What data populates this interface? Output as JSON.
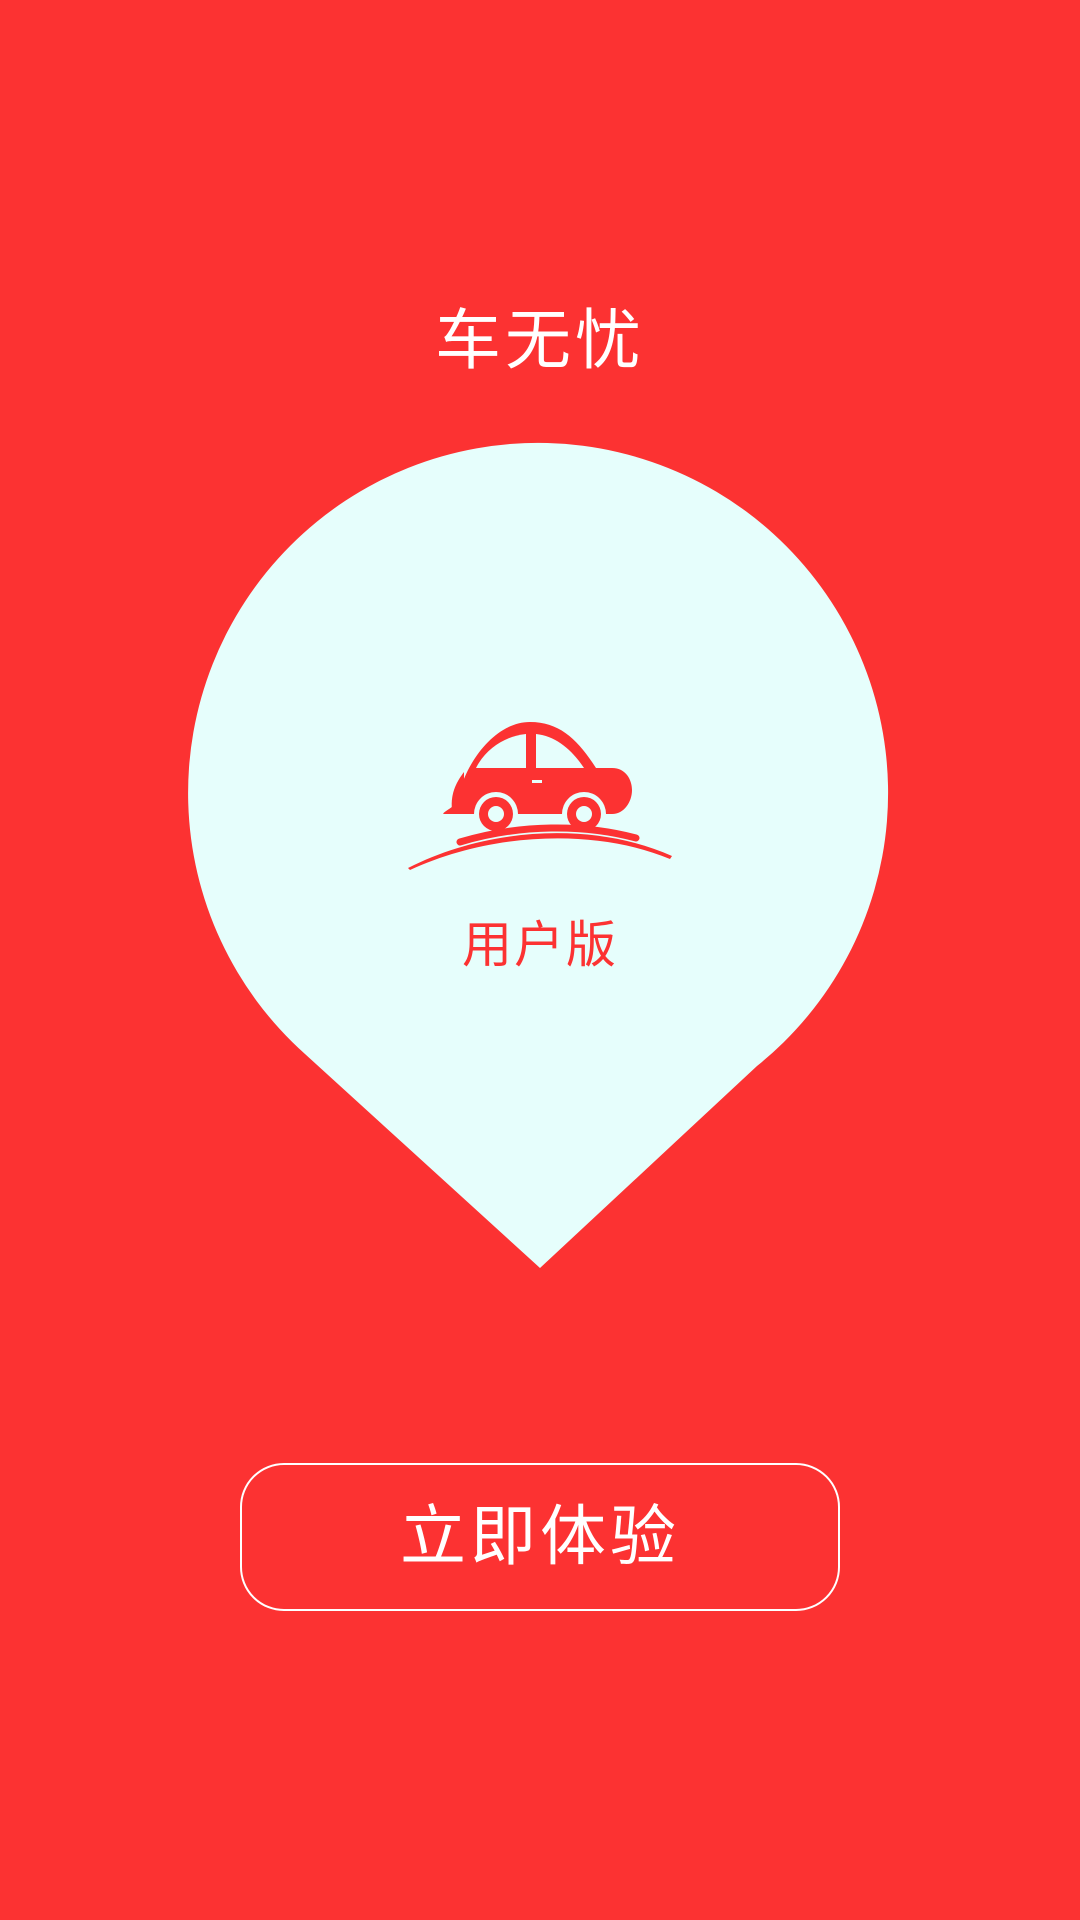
{
  "app": {
    "title": "车无忧"
  },
  "splash": {
    "edition_label": "用户版",
    "illustration_icon": "car-on-hill-icon",
    "cta_label": "立即体验"
  },
  "colors": {
    "background": "#fc3232",
    "pin_fill": "#e6fefc",
    "text_on_background": "#ffffff",
    "accent": "#fc3232"
  }
}
